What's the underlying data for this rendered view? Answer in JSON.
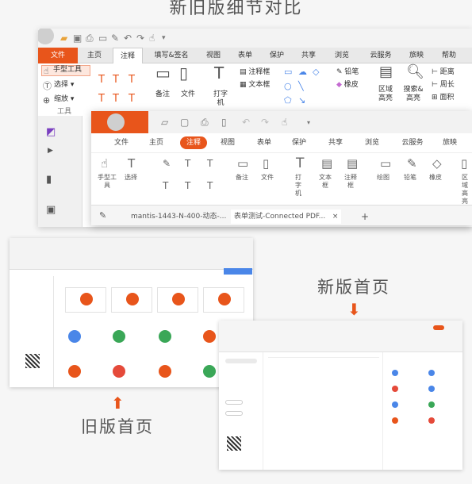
{
  "headline": "新旧版细节对比",
  "old_window": {
    "tabs": [
      "文件",
      "主页",
      "注释",
      "填写&签名",
      "视图",
      "表单",
      "保护",
      "共享",
      "浏览",
      "云服务",
      "旅映",
      "帮助"
    ],
    "active_tab": "注释",
    "tools": {
      "hand": "手型工具",
      "select": "选择",
      "zoom": "缩放",
      "group": "工具",
      "note": "备注",
      "file": "文件",
      "typewriter": "打字机",
      "note_box": "注释框",
      "text_box": "文本框",
      "pencil": "铅笔",
      "eraser": "橡皮",
      "area": "区域高亮",
      "search_highlight": "搜索&高亮",
      "distance": "距离",
      "perimeter": "周长",
      "area_measure": "面积"
    }
  },
  "new_window": {
    "tabs": [
      "文件",
      "主页",
      "注释",
      "视图",
      "表单",
      "保护",
      "共享",
      "浏览",
      "云服务",
      "旅映"
    ],
    "active_tab": "注释",
    "tools": {
      "hand": "手型工具",
      "select": "选择",
      "note": "备注",
      "file": "文件",
      "typewriter": "打字机",
      "text_box": "文本框",
      "note_box": "注释框",
      "shape": "绘图",
      "pencil": "铅笔",
      "eraser": "橡皮",
      "area": "区域高亮"
    },
    "doc_tabs": [
      "mantis-1443-N-400-动态-...",
      "表单测试-Connected PDF..."
    ],
    "close_glyph": "×",
    "add_glyph": "+"
  },
  "labels": {
    "new_home": "新版首页",
    "old_home": "旧版首页"
  },
  "colors": {
    "accent": "#e8551b",
    "blue": "#4a86e8",
    "green": "#3aa757",
    "red": "#e54a3a"
  }
}
